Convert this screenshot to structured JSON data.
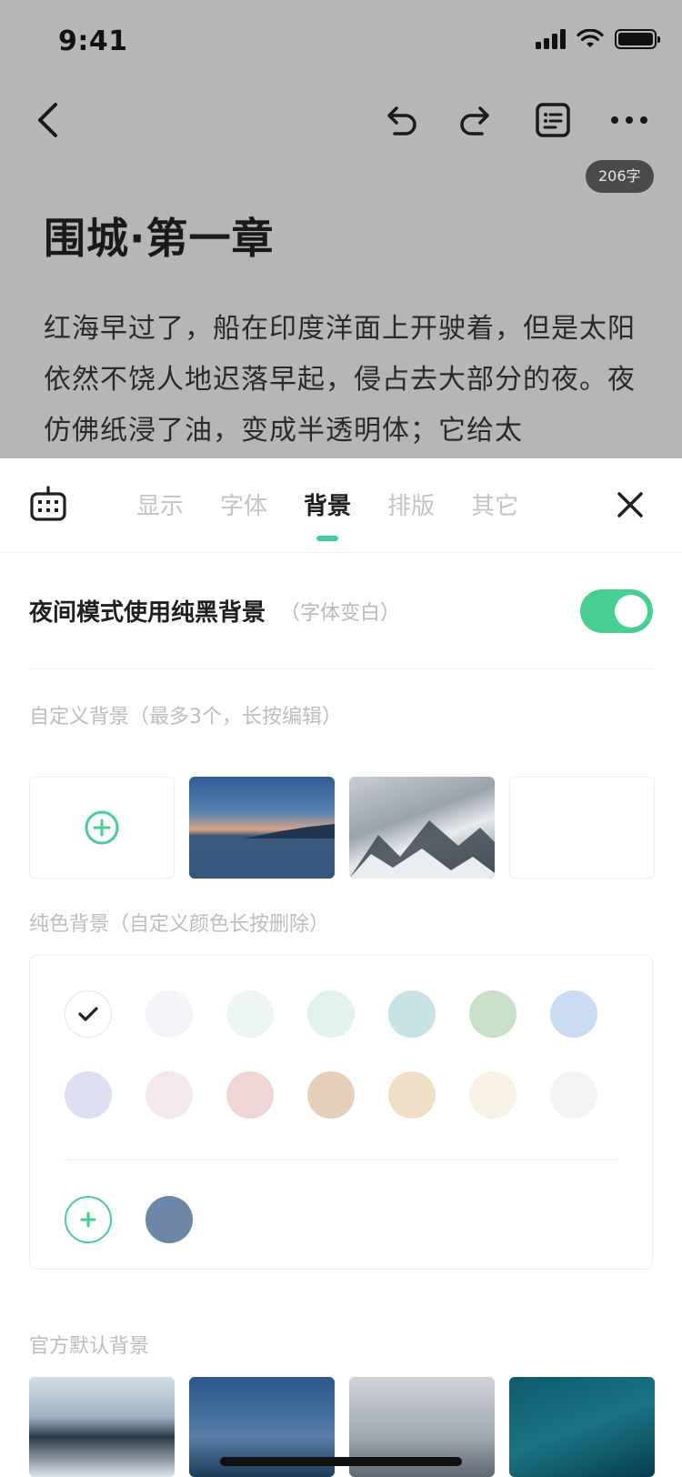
{
  "status_bar": {
    "time": "9:41"
  },
  "editor": {
    "word_count": "206字",
    "title": "围城·第一章",
    "body": "红海早过了，船在印度洋面上开驶着，但是太阳依然不饶人地迟落早起，侵占去大部分的夜。夜仿佛纸浸了油，变成半透明体；它给太"
  },
  "sheet": {
    "tabs": [
      {
        "label": "显示"
      },
      {
        "label": "字体"
      },
      {
        "label": "背景",
        "active": true
      },
      {
        "label": "排版"
      },
      {
        "label": "其它"
      }
    ],
    "night_mode": {
      "label": "夜间模式使用纯黑背景",
      "sub": "（字体变白）",
      "enabled": true
    },
    "custom_section": {
      "title": "自定义背景（最多3个，长按编辑）"
    },
    "solid_section": {
      "title": "纯色背景（自定义颜色长按删除）"
    },
    "official_section": {
      "title": "官方默认背景"
    },
    "swatches_row1": [
      "#ffffff",
      "#f3f4f7",
      "#ecf5f3",
      "#e1f3ec",
      "#c8e3e4",
      "#c9e1c9",
      "#c9dcf3"
    ],
    "swatches_row2": [
      "#dfe0f1",
      "#f4e8ee",
      "#f1d6d8",
      "#e6d0b9",
      "#f1e0c6",
      "#f7f0e4",
      "#f2f3f5"
    ],
    "custom_color": "#6c87a7",
    "accent_color": "#47cf92"
  }
}
